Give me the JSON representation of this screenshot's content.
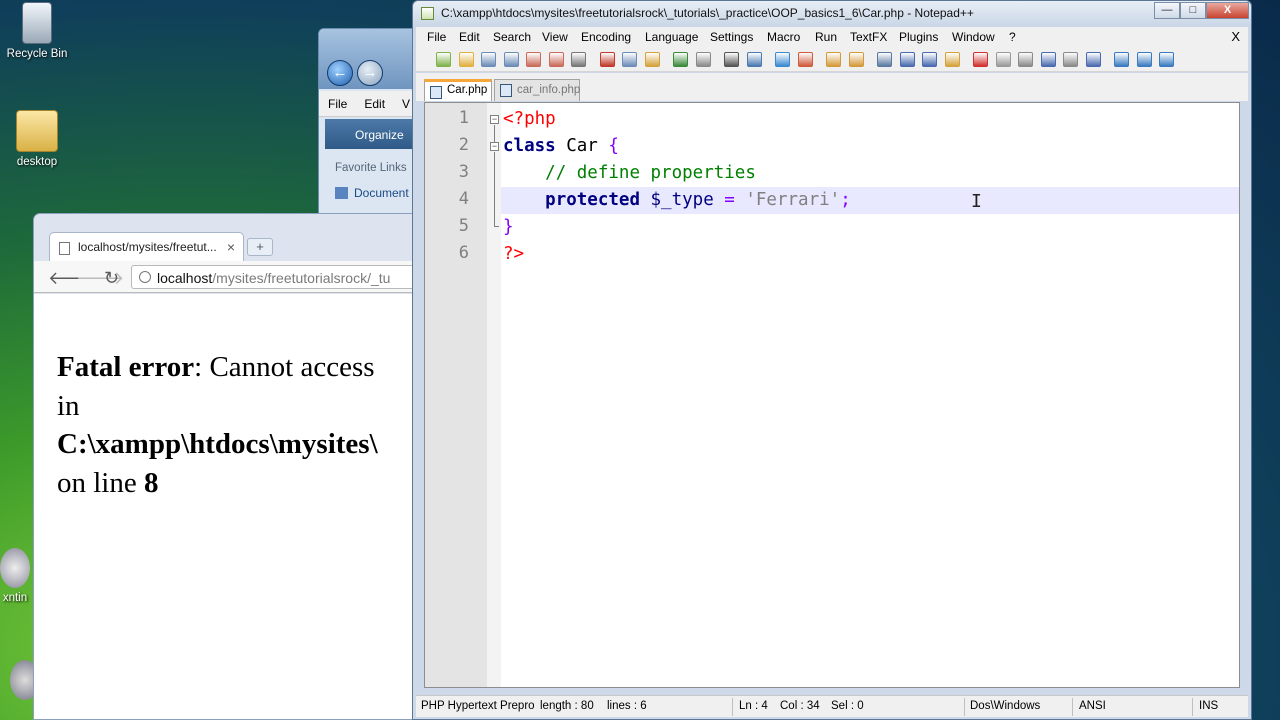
{
  "desktop": {
    "icons": [
      {
        "label": "Recycle Bin",
        "icon": "recycle-bin-icon"
      },
      {
        "label": "desktop",
        "icon": "folder-icon"
      },
      {
        "label": "xntin",
        "icon": "shortcut-icon"
      }
    ]
  },
  "explorer": {
    "menu": [
      "File",
      "Edit",
      "V"
    ],
    "organize_label": "Organize",
    "favorite_links_label": "Favorite Links",
    "documents_label": "Document"
  },
  "browser": {
    "tab_title": "localhost/mysites/freetut...",
    "tab_close": "×",
    "new_tab": "+",
    "url_host": "localhost",
    "url_path": "/mysites/freetutorialsrock/_tu",
    "error": {
      "label": "Fatal error",
      "message": ": Cannot access",
      "in_word": "in",
      "path": "C:\\xampp\\htdocs\\mysites\\",
      "line_prefix": "on line ",
      "line_number": "8"
    }
  },
  "notepad": {
    "title": "C:\\xampp\\htdocs\\mysites\\freetutorialsrock\\_tutorials\\_practice\\OOP_basics1_6\\Car.php - Notepad++",
    "window_buttons": {
      "minimize": "—",
      "maximize": "□",
      "close": "X"
    },
    "menu": [
      "File",
      "Edit",
      "Search",
      "View",
      "Encoding",
      "Language",
      "Settings",
      "Macro",
      "Run",
      "TextFX",
      "Plugins",
      "Window",
      "?"
    ],
    "menu_close": "X",
    "tabs": [
      {
        "label": "Car.php",
        "active": true
      },
      {
        "label": "car_info.php",
        "active": false
      }
    ],
    "line_numbers": [
      "1",
      "2",
      "3",
      "4",
      "5",
      "6"
    ],
    "code": {
      "l1_open": "<?php",
      "l2_kw": "class",
      "l2_name": " Car ",
      "l2_brace": "{",
      "l3_comment": "// define properties",
      "l4_kw": "protected",
      "l4_var": " $_type ",
      "l4_op": "=",
      "l4_str": " 'Ferrari'",
      "l4_semi": ";",
      "l5_brace": "}",
      "l6_close": "?>"
    },
    "status": {
      "lang": "PHP Hypertext Prepro",
      "length": "length : 80",
      "lines": "lines : 6",
      "ln": "Ln : 4",
      "col": "Col : 34",
      "sel": "Sel : 0",
      "eol": "Dos\\Windows",
      "encoding": "ANSI",
      "mode": "INS"
    },
    "toolbar_icons": [
      "new-icon",
      "open-icon",
      "save-icon",
      "save-all-icon",
      "close-icon",
      "close-all-icon",
      "print-icon",
      "cut-icon",
      "copy-icon",
      "paste-icon",
      "undo-icon",
      "redo-icon",
      "find-icon",
      "replace-icon",
      "zoom-in-icon",
      "zoom-out-icon",
      "sync-v-icon",
      "sync-h-icon",
      "wrap-icon",
      "all-chars-icon",
      "indent-guide-icon",
      "folder-icon",
      "record-icon",
      "stop-icon",
      "play-icon",
      "play-multi-icon",
      "save-macro-icon",
      "trim-icon",
      "up-icon",
      "down-icon",
      "collapse-icon"
    ]
  }
}
